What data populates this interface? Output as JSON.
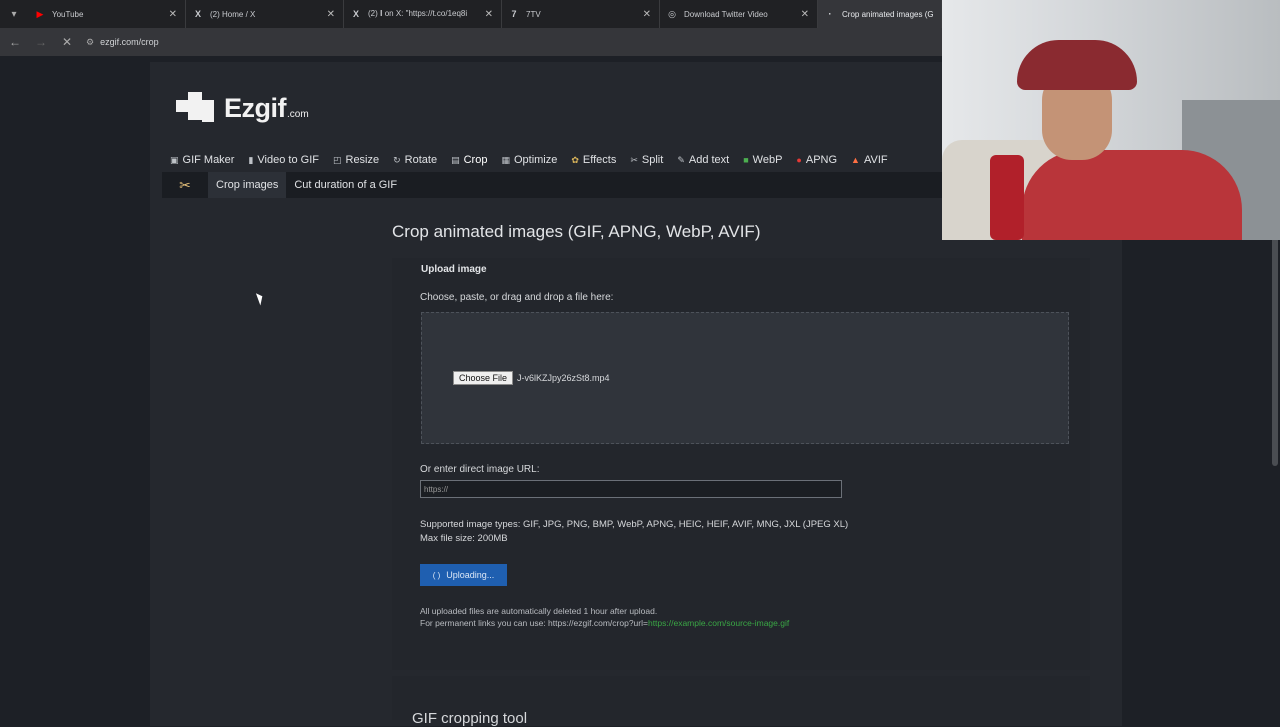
{
  "browser": {
    "tabs": [
      {
        "title": "YouTube",
        "icon": "youtube-icon"
      },
      {
        "title": "(2) Home / X",
        "icon": "x-icon"
      },
      {
        "title": "(2) 𝐈 on X: \"https://t.co/1eq8i",
        "icon": "x-icon"
      },
      {
        "title": "7TV",
        "icon": "7tv-icon"
      },
      {
        "title": "Download Twitter Video",
        "icon": "globe-icon"
      },
      {
        "title": "Crop animated images (GIF, A",
        "icon": "loading-icon"
      }
    ],
    "url": "ezgif.com/crop"
  },
  "site": {
    "logo_text": "Ezgif",
    "logo_suffix": ".com",
    "nav": [
      {
        "label": "GIF Maker",
        "icon": "camera-icon"
      },
      {
        "label": "Video to GIF",
        "icon": "film-icon"
      },
      {
        "label": "Resize",
        "icon": "resize-icon"
      },
      {
        "label": "Rotate",
        "icon": "rotate-icon"
      },
      {
        "label": "Crop",
        "icon": "crop-icon"
      },
      {
        "label": "Optimize",
        "icon": "optimize-icon"
      },
      {
        "label": "Effects",
        "icon": "effects-icon"
      },
      {
        "label": "Split",
        "icon": "split-icon"
      },
      {
        "label": "Add text",
        "icon": "text-icon"
      },
      {
        "label": "WebP",
        "icon": "webp-icon"
      },
      {
        "label": "APNG",
        "icon": "apng-icon"
      },
      {
        "label": "AVIF",
        "icon": "avif-icon"
      }
    ],
    "subnav": [
      "Crop images",
      "Cut duration of a GIF"
    ]
  },
  "main": {
    "title": "Crop animated images (GIF, APNG, WebP, AVIF)",
    "upload_heading": "Upload image",
    "choose_label": "Choose, paste, or drag and drop a file here:",
    "choose_button": "Choose File",
    "file_name": "J-v6lKZJpy26zSt8.mp4",
    "url_label": "Or enter direct image URL:",
    "url_placeholder": "https://",
    "supported_types": "Supported image types: GIF, JPG, PNG, BMP, WebP, APNG, HEIC, HEIF, AVIF, MNG, JXL (JPEG XL)",
    "max_size": "Max file size: 200MB",
    "upload_button": "Uploading...",
    "note_line1": "All uploaded files are automatically deleted 1 hour after upload.",
    "note_line2_prefix": "For permanent links you can use: https://ezgif.com/crop?url=",
    "note_line2_link": "https://example.com/source-image.gif",
    "next_section_title": "GIF cropping tool"
  },
  "colors": {
    "accent": "#1f5fb0",
    "link": "#3aa745"
  }
}
